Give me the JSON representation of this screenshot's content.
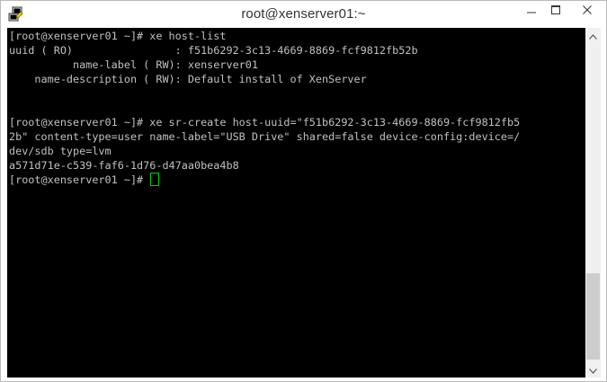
{
  "window": {
    "title": "root@xenserver01:~"
  },
  "icons": {
    "app": "putty-icon",
    "minimize": "minimize-icon",
    "maximize": "maximize-icon",
    "close": "close-icon",
    "scroll_up": "arrow-up-icon",
    "scroll_down": "arrow-down-icon"
  },
  "colors": {
    "terminal_bg": "#000000",
    "terminal_text": "#c0c0c0",
    "cursor": "#00d000"
  },
  "terminal": {
    "lines": [
      "[root@xenserver01 ~]# xe host-list",
      "uuid ( RO)                : f51b6292-3c13-4669-8869-fcf9812fb52b",
      "          name-label ( RW): xenserver01",
      "    name-description ( RW): Default install of XenServer",
      "",
      "",
      "[root@xenserver01 ~]# xe sr-create host-uuid=\"f51b6292-3c13-4669-8869-fcf9812fb5",
      "2b\" content-type=user name-label=\"USB Drive\" shared=false device-config:device=/",
      "dev/sdb type=lvm",
      "a571d71e-c539-faf6-1d76-d47aa0bea4b8"
    ],
    "prompt": "[root@xenserver01 ~]# "
  }
}
